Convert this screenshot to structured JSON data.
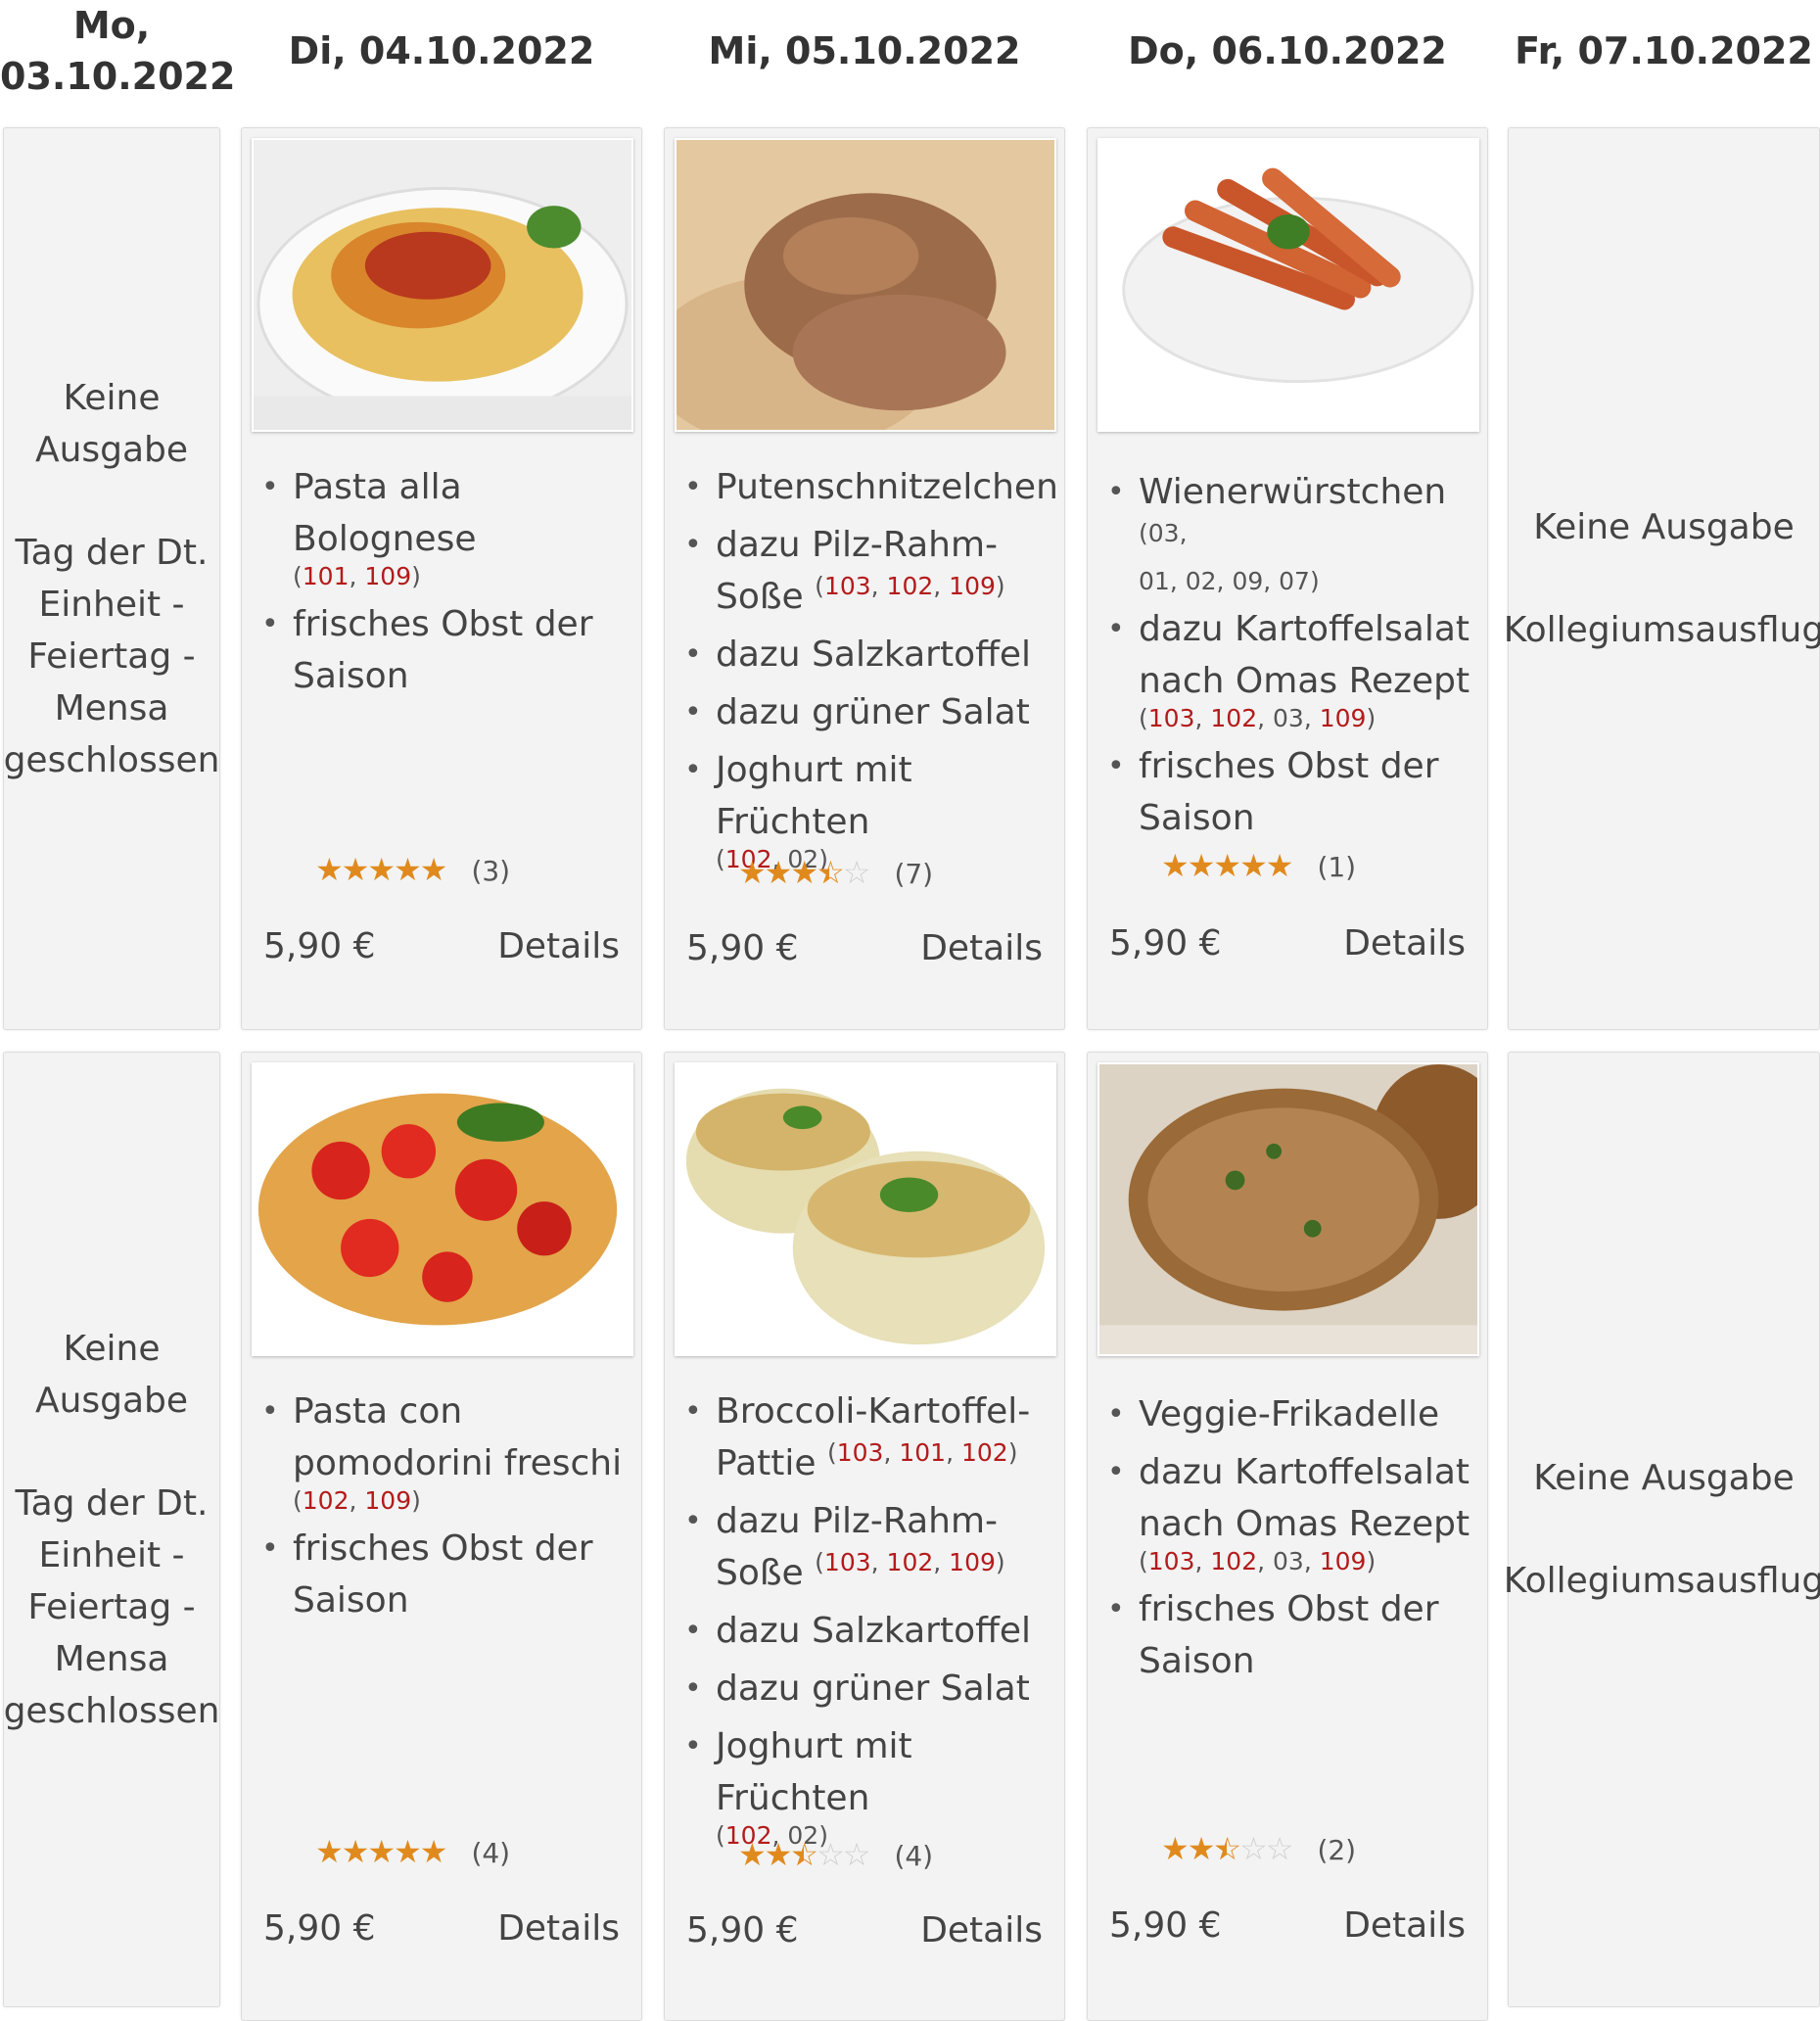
{
  "days": [
    {
      "label_line1": "Mo,",
      "label_line2": "03.10.2022"
    },
    {
      "label": "Di, 04.10.2022"
    },
    {
      "label": "Mi, 05.10.2022"
    },
    {
      "label": "Do, 06.10.2022"
    },
    {
      "label": "Fr, 07.10.2022"
    }
  ],
  "monday": {
    "l1": "Keine",
    "l2": "Ausgabe",
    "l3": "Tag der Dt.",
    "l4": "Einheit -",
    "l5": "Feiertag -",
    "l6": "Mensa",
    "l7": "geschlossen"
  },
  "friday": {
    "l1": "Keine Ausgabe",
    "l2": "Kollegiumsausflug"
  },
  "row1": {
    "tue": {
      "items": [
        "Pasta alla Bolognese",
        "frisches Obst der Saison"
      ],
      "allergens": [
        "101",
        "109"
      ],
      "stars": 5,
      "count": "(3)",
      "price": "5,90 €",
      "details": "Details"
    },
    "wed": {
      "items": [
        "Putenschnitzelchen",
        "dazu Pilz-Rahm-Soße",
        "dazu Salzkartoffel",
        "dazu grüner Salat",
        "Joghurt mit Früchten"
      ],
      "allergens_sauce": [
        "103",
        "102",
        "109"
      ],
      "allergens_yog": [
        "102",
        "02"
      ],
      "stars": 3.5,
      "count": "(7)",
      "price": "5,90 €",
      "details": "Details"
    },
    "thu": {
      "items": [
        "Wienerwürstchen",
        "dazu Kartoffelsalat nach Omas Rezept",
        "frisches Obst der Saison"
      ],
      "allergens_wurst": [
        "03",
        "01",
        "02",
        "09",
        "07"
      ],
      "allergens_salat": [
        "103",
        "102",
        "03",
        "109"
      ],
      "stars": 5,
      "count": "(1)",
      "price": "5,90 €",
      "details": "Details"
    }
  },
  "row2": {
    "tue": {
      "items": [
        "Pasta con pomodorini freschi",
        "frisches Obst der Saison"
      ],
      "allergens": [
        "102",
        "109"
      ],
      "stars": 5,
      "count": "(4)",
      "price": "5,90 €",
      "details": "Details"
    },
    "wed": {
      "items": [
        "Broccoli-Kartoffel-Pattie",
        "dazu Pilz-Rahm-Soße",
        "dazu Salzkartoffel",
        "dazu grüner Salat",
        "Joghurt mit Früchten"
      ],
      "allergens_pattie": [
        "103",
        "101",
        "102"
      ],
      "allergens_sauce": [
        "103",
        "102",
        "109"
      ],
      "allergens_yog": [
        "102",
        "02"
      ],
      "stars": 2.5,
      "count": "(4)",
      "price": "5,90 €",
      "details": "Details"
    },
    "thu": {
      "items": [
        "Veggie-Frikadelle",
        "dazu Kartoffelsalat nach Omas Rezept",
        "frisches Obst der Saison"
      ],
      "allergens_salat": [
        "103",
        "102",
        "03",
        "109"
      ],
      "stars": 2.5,
      "count": "(2)",
      "price": "5,90 €",
      "details": "Details"
    }
  },
  "colors": {
    "card_bg": "#f3f3f3",
    "star": "#e08a1e",
    "allergen_red": "#b31b1b"
  }
}
